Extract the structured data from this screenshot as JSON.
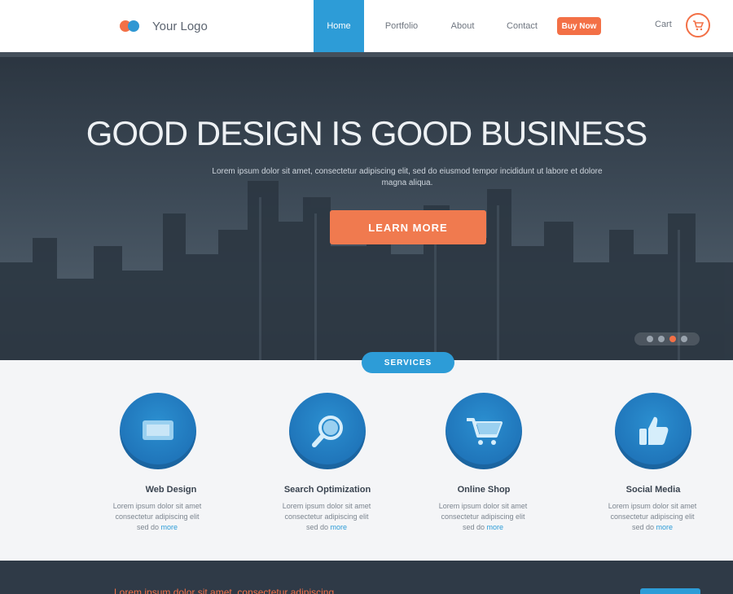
{
  "header": {
    "logo_text": "Your Logo",
    "nav": [
      "Home",
      "Portfolio",
      "About",
      "Contact"
    ],
    "badge_label": "Buy Now",
    "cart_label": "Cart"
  },
  "hero": {
    "title": "GOOD DESIGN IS GOOD BUSINESS",
    "subtitle": "Lorem ipsum dolor sit amet, consectetur adipiscing elit, sed do eiusmod tempor incididunt ut labore et dolore magna aliqua.",
    "button_label": "LEARN MORE"
  },
  "services": {
    "tag": "SERVICES",
    "items": [
      {
        "icon": "monitor-icon",
        "title": "Web Design",
        "desc": "Lorem ipsum dolor sit amet consectetur adipiscing elit sed do",
        "more": "more"
      },
      {
        "icon": "magnifier-icon",
        "title": "Search Optimization",
        "desc": "Lorem ipsum dolor sit amet consectetur adipiscing elit sed do",
        "more": "more"
      },
      {
        "icon": "cart-icon",
        "title": "Online Shop",
        "desc": "Lorem ipsum dolor sit amet consectetur adipiscing elit sed do",
        "more": "more"
      },
      {
        "icon": "thumbs-up-icon",
        "title": "Social Media",
        "desc": "Lorem ipsum dolor sit amet consectetur adipiscing elit sed do",
        "more": "more"
      }
    ]
  },
  "strip": {
    "text": "Lorem ipsum dolor sit amet, consectetur adipiscing"
  },
  "colors": {
    "accent_blue": "#2d9cd7",
    "accent_orange": "#f37046",
    "dark": "#2f3a47"
  }
}
